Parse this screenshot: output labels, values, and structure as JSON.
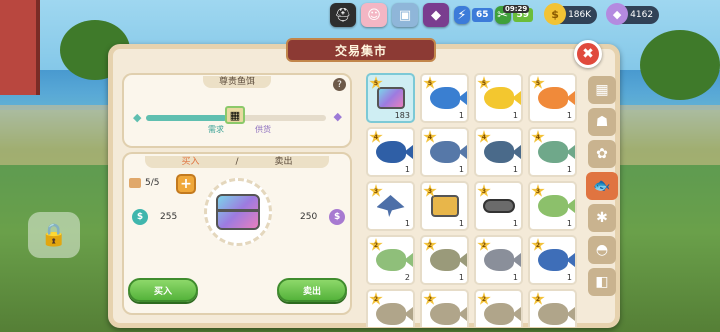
{
  "window": {
    "title": "交易集市",
    "close_label": "✖"
  },
  "hud": {
    "clock": "09:29",
    "energy_value": "65",
    "stamina_value": "59",
    "coins": "186K",
    "gems": "4162"
  },
  "bait_panel": {
    "title": "尊贵鱼饵",
    "help_label": "?",
    "demand_label": "需求",
    "supply_label": "供货",
    "supply_level": 0.45
  },
  "trade_panel": {
    "title_buy": "买入",
    "title_sep": "/",
    "title_sell": "卖出",
    "quantity": "5/5",
    "plus_label": "+",
    "buy_price": "255",
    "sell_price": "250",
    "buy_button": "买入",
    "sell_button": "卖出"
  },
  "items": [
    {
      "icon": "rainbow-chest-icon",
      "count": "183",
      "stars": "5",
      "selected": true
    },
    {
      "icon": "blue-fish-icon",
      "count": "1",
      "stars": "5"
    },
    {
      "icon": "yellow-butterflyfish-icon",
      "count": "1",
      "stars": "5"
    },
    {
      "icon": "goldfish-icon",
      "count": "1",
      "stars": "5"
    },
    {
      "icon": "blue-spotted-fish-icon",
      "count": "1",
      "stars": "4"
    },
    {
      "icon": "swordfish-icon",
      "count": "1",
      "stars": "4"
    },
    {
      "icon": "shark-icon",
      "count": "1",
      "stars": "4"
    },
    {
      "icon": "green-fish-icon",
      "count": "1",
      "stars": "4"
    },
    {
      "icon": "stingray-icon",
      "count": "1",
      "stars": "3"
    },
    {
      "icon": "gold-chest-icon",
      "count": "1",
      "stars": "3"
    },
    {
      "icon": "eel-icon",
      "count": "1",
      "stars": "3"
    },
    {
      "icon": "green-trout-icon",
      "count": "1",
      "stars": "3"
    },
    {
      "icon": "frog-fish-icon",
      "count": "2",
      "stars": "2"
    },
    {
      "icon": "pike-icon",
      "count": "1",
      "stars": "2"
    },
    {
      "icon": "sturgeon-icon",
      "count": "1",
      "stars": "2"
    },
    {
      "icon": "sailfish-icon",
      "count": "1",
      "stars": "2"
    },
    {
      "icon": "fish-icon",
      "count": "",
      "stars": "2"
    },
    {
      "icon": "fish-icon",
      "count": "",
      "stars": "2"
    },
    {
      "icon": "fish-icon",
      "count": "",
      "stars": "2"
    },
    {
      "icon": "fish-icon",
      "count": "",
      "stars": "2"
    }
  ],
  "tabs": [
    {
      "icon": "grid-icon",
      "label": "▦"
    },
    {
      "icon": "pile-icon",
      "label": "☗"
    },
    {
      "icon": "flower-icon",
      "label": "✿"
    },
    {
      "icon": "fish-tab-icon",
      "label": "🐟",
      "active": true
    },
    {
      "icon": "beetle-icon",
      "label": "✱"
    },
    {
      "icon": "shell-icon",
      "label": "◓"
    },
    {
      "icon": "tile-icon",
      "label": "◧"
    }
  ]
}
